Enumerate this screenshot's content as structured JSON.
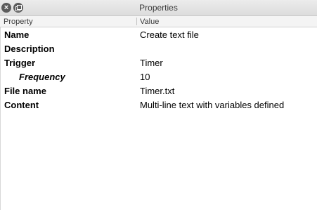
{
  "window": {
    "title": "Properties"
  },
  "columns": {
    "property": "Property",
    "value": "Value"
  },
  "rows": [
    {
      "key": "Name",
      "value": "Create text file"
    },
    {
      "key": "Description",
      "value": ""
    },
    {
      "key": "Trigger",
      "value": "Timer"
    },
    {
      "key": "Frequency",
      "value": "10"
    },
    {
      "key": "File name",
      "value": "Timer.txt"
    },
    {
      "key": "Content",
      "value": "Multi-line text with variables defined"
    }
  ]
}
